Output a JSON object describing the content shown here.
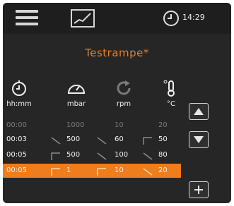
{
  "topbar": {
    "menu_icon": "hamburger-menu-icon",
    "chart_icon": "chart-icon",
    "clock_icon": "clock-icon",
    "time": "14:29"
  },
  "title": "Testrampe*",
  "columns": [
    {
      "icon": "time-icon",
      "label": "hh:mm"
    },
    {
      "icon": "gauge-icon",
      "label": "mbar"
    },
    {
      "icon": "rotation-icon",
      "label": "rpm"
    },
    {
      "icon": "thermometer-icon",
      "label": "°C"
    }
  ],
  "rows": [
    {
      "time": "00:00",
      "mbar": "1000",
      "rpm": "10",
      "temp": "20",
      "ramps": [
        "",
        "",
        ""
      ],
      "state": "dim"
    },
    {
      "time": "00:03",
      "mbar": "500",
      "rpm": "60",
      "temp": "50",
      "ramps": [
        "down",
        "down",
        "step-up"
      ],
      "state": "normal"
    },
    {
      "time": "00:05",
      "mbar": "500",
      "rpm": "100",
      "temp": "80",
      "ramps": [
        "step-up",
        "down",
        "down"
      ],
      "state": "normal"
    },
    {
      "time": "00:05",
      "mbar": "1",
      "rpm": "10",
      "temp": "20",
      "ramps": [
        "step-up",
        "step-up",
        "down"
      ],
      "state": "active"
    }
  ],
  "side_buttons": [
    "up-arrow-icon",
    "down-arrow-icon",
    "plus-icon"
  ],
  "colors": {
    "accent": "#ef7d1c",
    "background": "#262626",
    "text": "#f2f2f2"
  }
}
